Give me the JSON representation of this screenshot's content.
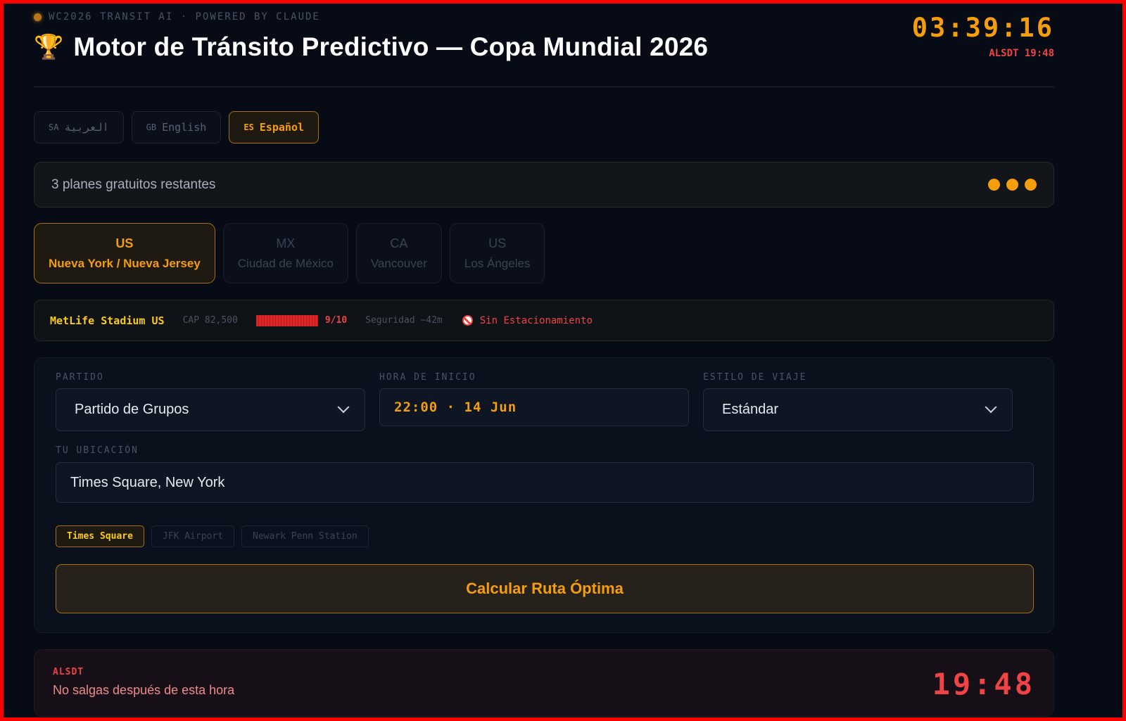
{
  "header": {
    "brand": "WC2026 TRANSIT AI · POWERED BY CLAUDE",
    "trophy": "🏆",
    "title": "Motor de Tránsito Predictivo — Copa Mundial 2026",
    "clock": "03:39:16",
    "alsdt": "ALSDT 19:48"
  },
  "languages": [
    {
      "code": "SA",
      "label": "العربية",
      "active": false
    },
    {
      "code": "GB",
      "label": "English",
      "active": false
    },
    {
      "code": "ES",
      "label": "Español",
      "active": true
    }
  ],
  "plans": {
    "text": "3 planes gratuitos restantes",
    "remaining": 3
  },
  "cities": [
    {
      "code": "US",
      "name": "Nueva York / Nueva Jersey",
      "active": true
    },
    {
      "code": "MX",
      "name": "Ciudad de México",
      "active": false
    },
    {
      "code": "CA",
      "name": "Vancouver",
      "active": false
    },
    {
      "code": "US",
      "name": "Los Ángeles",
      "active": false
    }
  ],
  "stadium": {
    "name": "MetLife Stadium US",
    "capacity": "CAP 82,500",
    "score": "9/10",
    "score_value": 0.9,
    "security": "Seguridad ~42m",
    "parking": "Sin Estacionamiento"
  },
  "form": {
    "match_label": "PARTIDO",
    "match_value": "Partido de Grupos",
    "time_label": "HORA DE INICIO",
    "time_value": "22:00 · 14 Jun",
    "style_label": "ESTILO DE VIAJE",
    "style_value": "Estándar",
    "location_label": "TU UBICACIÓN",
    "location_value": "Times Square, New York",
    "chips": [
      {
        "label": "Times Square",
        "active": true
      },
      {
        "label": "JFK Airport",
        "active": false
      },
      {
        "label": "Newark Penn Station",
        "active": false
      }
    ],
    "cta": "Calcular Ruta Óptima"
  },
  "warning": {
    "tag": "ALSDT",
    "message": "No salgas después de esta hora",
    "time": "19:48"
  },
  "colors": {
    "accent": "#f59e0b",
    "danger": "#ef4444",
    "background": "#060b16"
  }
}
